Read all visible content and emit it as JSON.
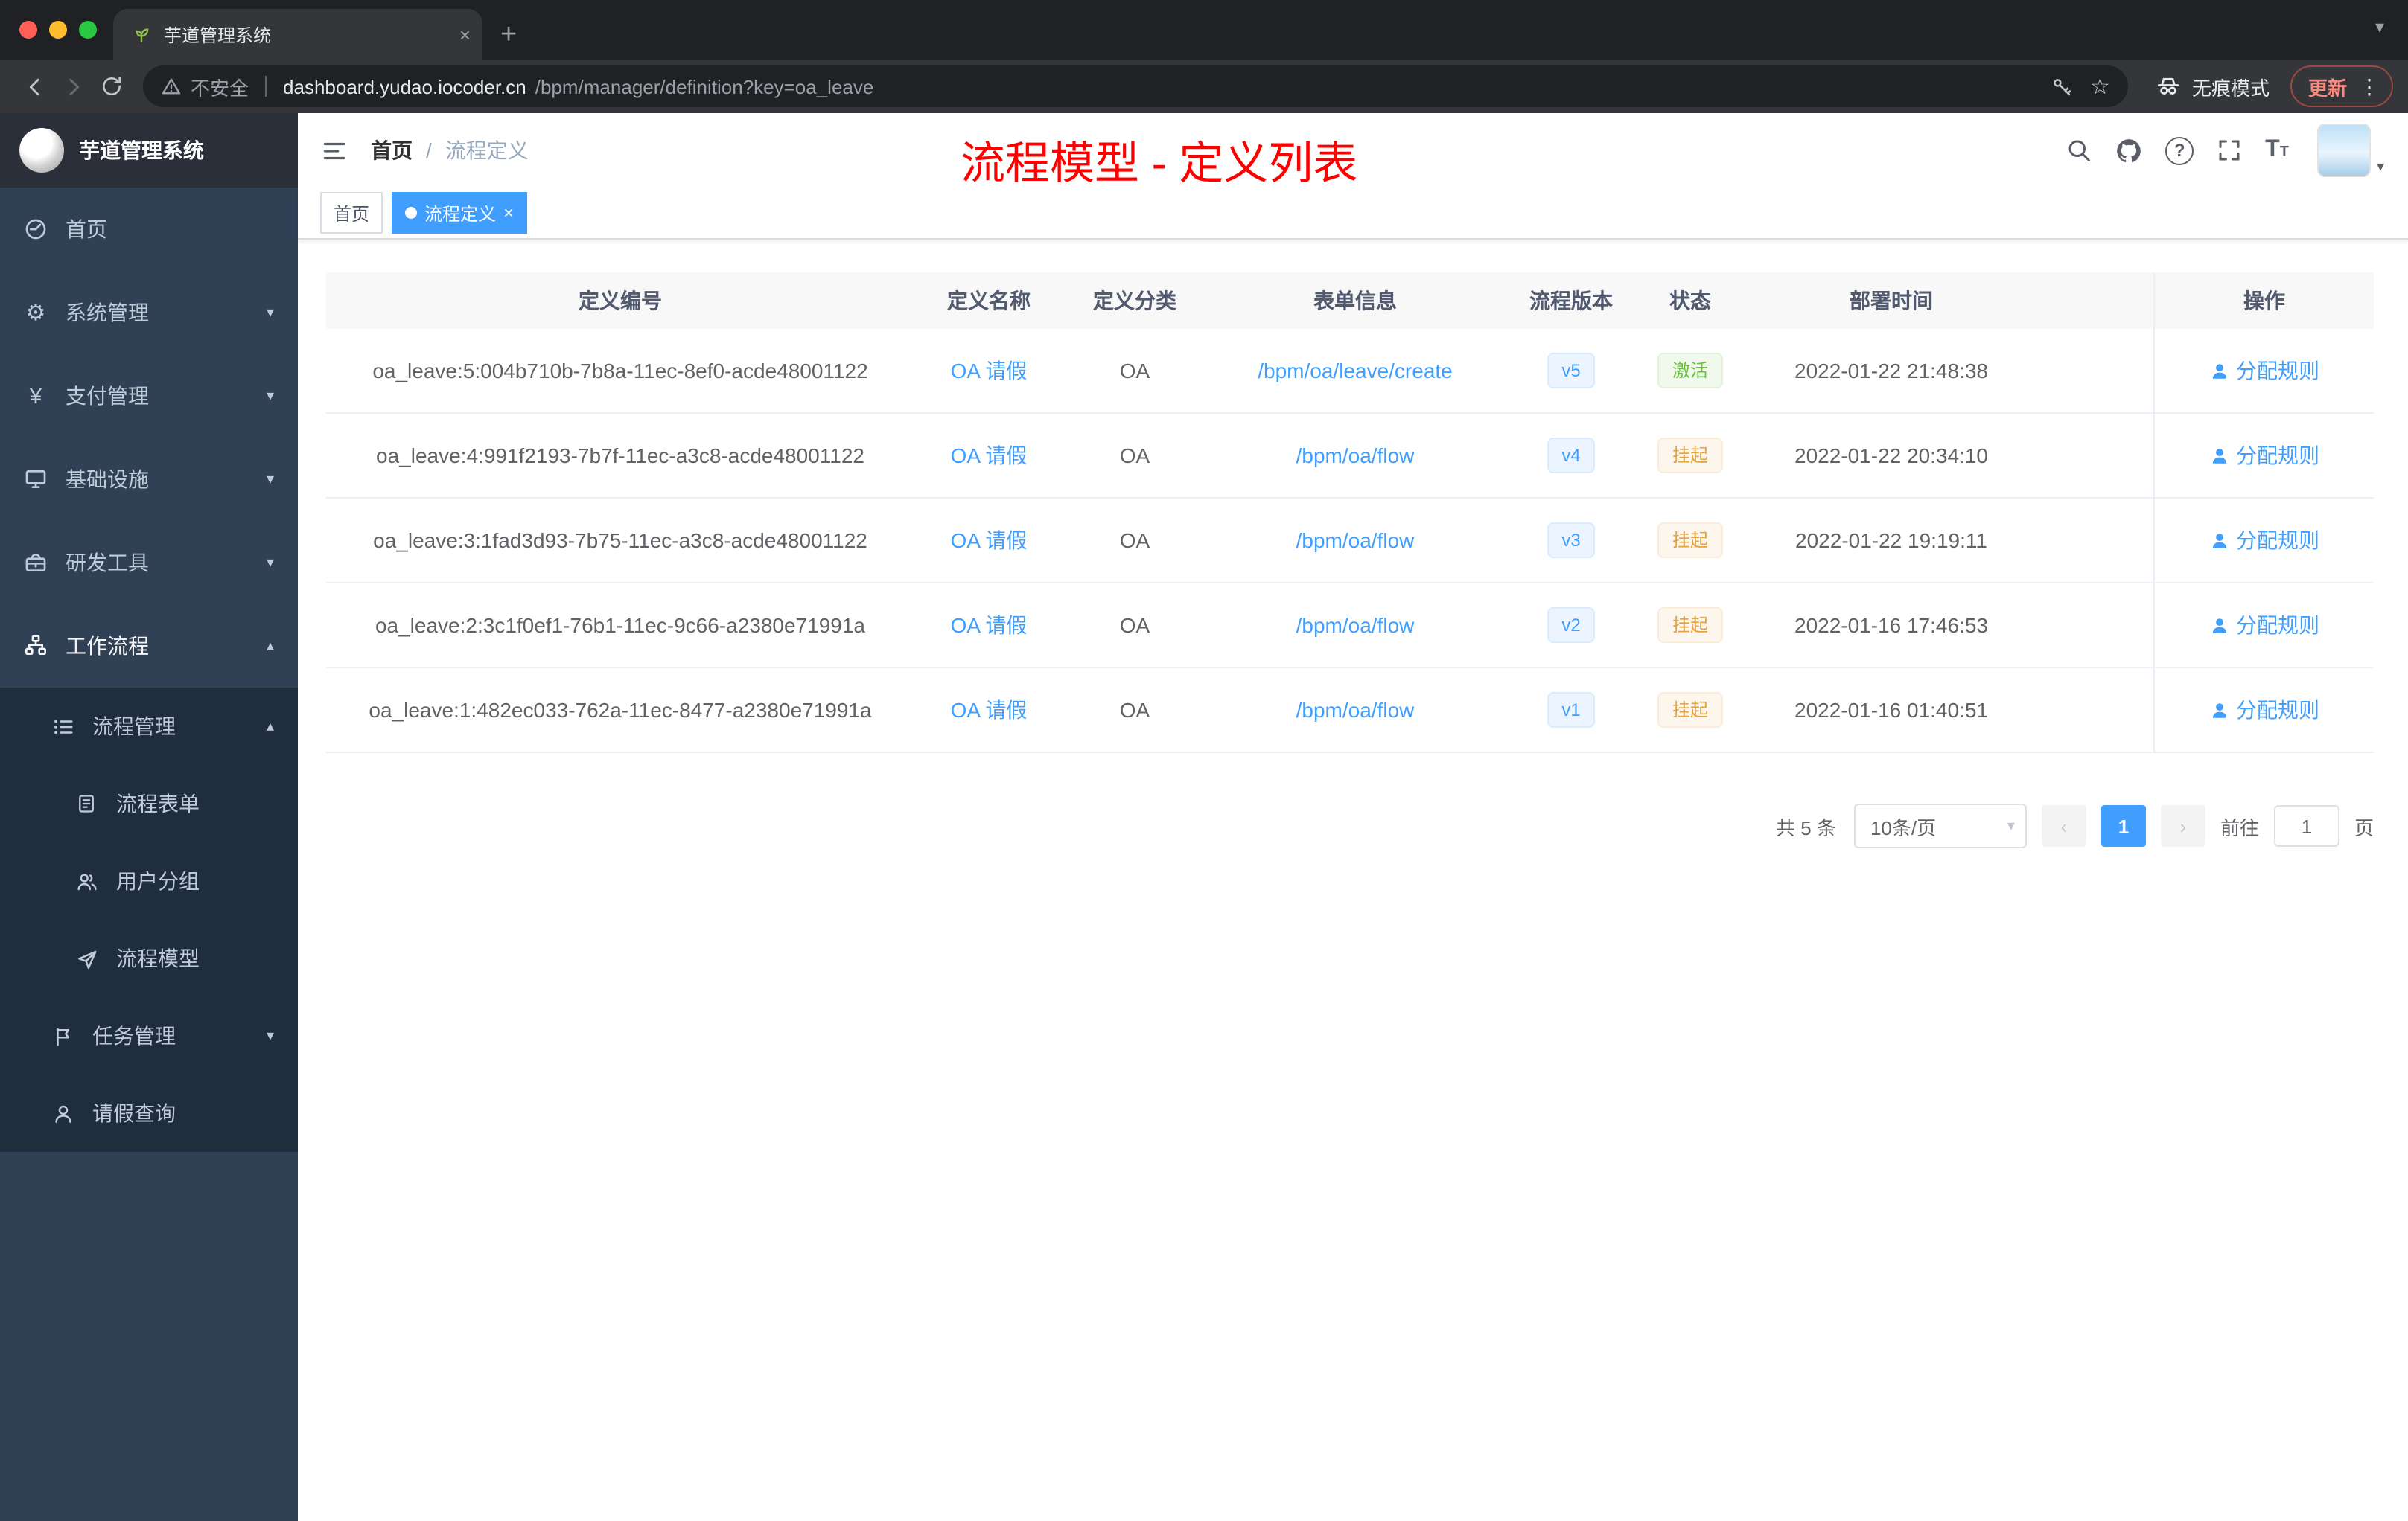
{
  "colors": {
    "accent": "#409eff",
    "success": "#67c23a",
    "warning": "#e6a23c",
    "annotation_red": "#ff0000",
    "sidebar_bg": "#304156",
    "submenu_bg": "#1f2d3d"
  },
  "icons": {
    "close": "×",
    "plus": "+",
    "chevron_down": "▾",
    "chevron_up": "▴",
    "caret_down": "▾",
    "prev": "‹",
    "next": "›",
    "kebab": "⋮",
    "star": "☆",
    "help": "?",
    "yen": "¥",
    "gear": "⚙",
    "font_size": "T"
  },
  "browser": {
    "tab_title": "芋道管理系统",
    "security_label": "不安全",
    "url_host": "dashboard.yudao.iocoder.cn",
    "url_path": "/bpm/manager/definition?key=oa_leave",
    "incognito_label": "无痕模式",
    "update_label": "更新"
  },
  "sidebar": {
    "title": "芋道管理系统",
    "menu": [
      {
        "label": "首页"
      },
      {
        "label": "系统管理"
      },
      {
        "label": "支付管理"
      },
      {
        "label": "基础设施"
      },
      {
        "label": "研发工具"
      },
      {
        "label": "工作流程"
      }
    ],
    "process_group": {
      "label": "流程管理"
    },
    "process_items": [
      {
        "label": "流程表单"
      },
      {
        "label": "用户分组"
      },
      {
        "label": "流程模型"
      }
    ],
    "task_item": {
      "label": "任务管理"
    },
    "leave_item": {
      "label": "请假查询"
    }
  },
  "navbar": {
    "breadcrumb": [
      {
        "label": "首页"
      },
      {
        "label": "流程定义"
      }
    ],
    "breadcrumb_separator": "/",
    "annotation": "流程模型 - 定义列表"
  },
  "tags": [
    {
      "label": "首页"
    },
    {
      "label": "流程定义"
    }
  ],
  "table": {
    "headers": [
      "定义编号",
      "定义名称",
      "定义分类",
      "表单信息",
      "流程版本",
      "状态",
      "部署时间",
      "操作"
    ],
    "rows": [
      {
        "id": "oa_leave:5:004b710b-7b8a-11ec-8ef0-acde48001122",
        "name": "OA 请假",
        "category": "OA",
        "form": "/bpm/oa/leave/create",
        "version": "v5",
        "status": "激活",
        "time": "2022-01-22 21:48:38",
        "action": "分配规则"
      },
      {
        "id": "oa_leave:4:991f2193-7b7f-11ec-a3c8-acde48001122",
        "name": "OA 请假",
        "category": "OA",
        "form": "/bpm/oa/flow",
        "version": "v4",
        "status": "挂起",
        "time": "2022-01-22 20:34:10",
        "action": "分配规则"
      },
      {
        "id": "oa_leave:3:1fad3d93-7b75-11ec-a3c8-acde48001122",
        "name": "OA 请假",
        "category": "OA",
        "form": "/bpm/oa/flow",
        "version": "v3",
        "status": "挂起",
        "time": "2022-01-22 19:19:11",
        "action": "分配规则"
      },
      {
        "id": "oa_leave:2:3c1f0ef1-76b1-11ec-9c66-a2380e71991a",
        "name": "OA 请假",
        "category": "OA",
        "form": "/bpm/oa/flow",
        "version": "v2",
        "status": "挂起",
        "time": "2022-01-16 17:46:53",
        "action": "分配规则"
      },
      {
        "id": "oa_leave:1:482ec033-762a-11ec-8477-a2380e71991a",
        "name": "OA 请假",
        "category": "OA",
        "form": "/bpm/oa/flow",
        "version": "v1",
        "status": "挂起",
        "time": "2022-01-16 01:40:51",
        "action": "分配规则"
      }
    ]
  },
  "pagination": {
    "total": "共 5 条",
    "page_size": "10条/页",
    "current_page": "1",
    "goto_label": "前往",
    "goto_value": "1",
    "page_unit": "页"
  }
}
